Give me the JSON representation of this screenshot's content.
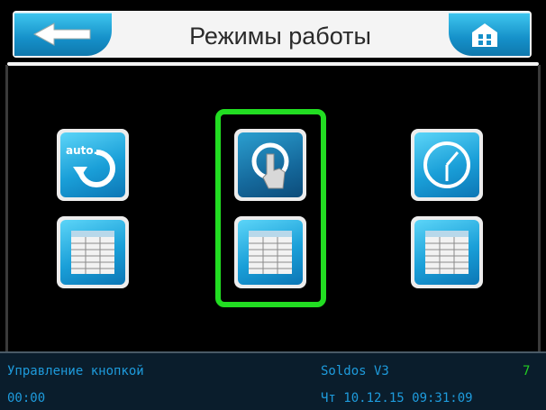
{
  "header": {
    "title": "Режимы работы",
    "back_icon": "arrow-left-icon",
    "home_icon": "home-icon"
  },
  "modes": {
    "auto_label": "auto.",
    "auto_icon": "auto-cycle-icon",
    "manual_icon": "touch-button-icon",
    "timer_icon": "clock-icon",
    "table_icon": "table-icon",
    "selected": "manual"
  },
  "status": {
    "mode_text": "Управление кнопкой",
    "device": "Soldos V3",
    "number": "7",
    "timer": "00:00",
    "datetime": "Чт 10.12.15 09:31:09"
  },
  "colors": {
    "accent_blue": "#1a9fd8",
    "selection_green": "#22dd22",
    "status_text": "#1e9bdc",
    "status_number": "#22cc22"
  }
}
